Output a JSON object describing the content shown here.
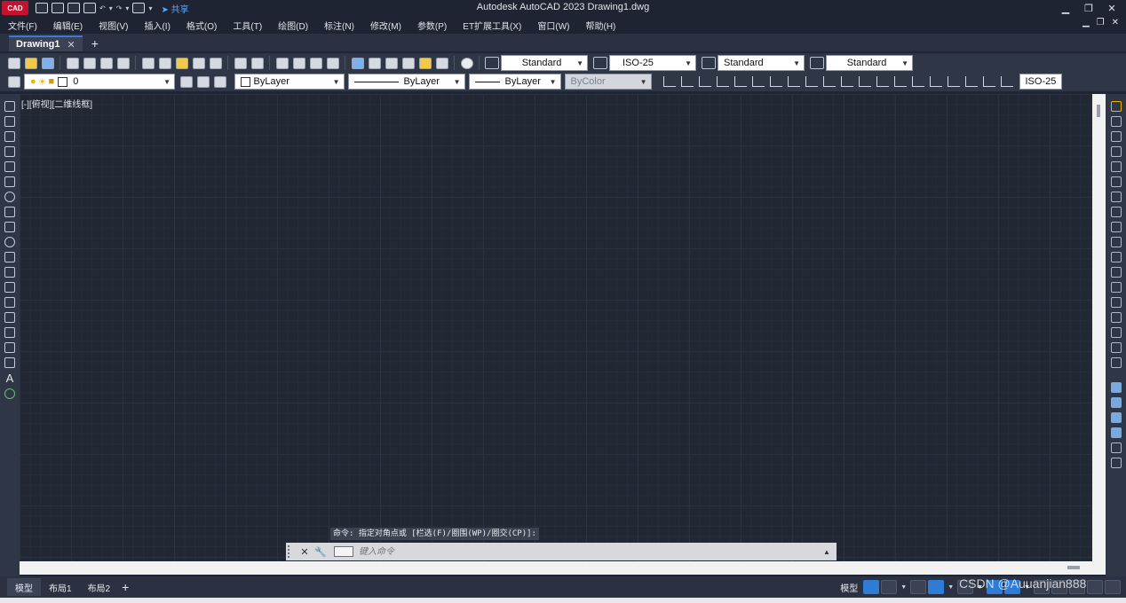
{
  "titlebar": {
    "logo_text": "CAD",
    "share_label": "共享",
    "title": "Autodesk AutoCAD 2023    Drawing1.dwg",
    "minimize": "▁",
    "restore": "❐",
    "close": "✕"
  },
  "menu": {
    "items": [
      "文件(F)",
      "编辑(E)",
      "视图(V)",
      "插入(I)",
      "格式(O)",
      "工具(T)",
      "绘图(D)",
      "标注(N)",
      "修改(M)",
      "参数(P)",
      "ET扩展工具(X)",
      "窗口(W)",
      "帮助(H)"
    ],
    "doc_minimize": "▁",
    "doc_restore": "❐",
    "doc_close": "✕"
  },
  "file_tabs": {
    "active": "Drawing1",
    "close": "✕",
    "add": "+"
  },
  "toolbar1": {
    "text_style": "Standard",
    "dim_style": "ISO-25",
    "table_style": "Standard",
    "mleader_style": "Standard"
  },
  "toolbar2": {
    "layer": "0",
    "color": "ByLayer",
    "linetype": "ByLayer",
    "lineweight": "ByLayer",
    "plot_style": "ByColor",
    "dim_style_right": "ISO-25"
  },
  "left_tools": {
    "text_tool": "A"
  },
  "viewport": {
    "label": "[-][俯视][二维线框]"
  },
  "command": {
    "history": "命令: 指定对角点或 [栏选(F)/圈围(WP)/圈交(CP)]:",
    "close": "✕",
    "customize": "🔧",
    "placeholder": "键入命令",
    "expand": "▲"
  },
  "layout_tabs": {
    "items": [
      "模型",
      "布局1",
      "布局2"
    ],
    "add": "+"
  },
  "statusbar": {
    "model": "模型"
  },
  "watermark": "CSDN @Auuanjian888",
  "colors": {
    "accent": "#3a7bd5",
    "logo": "#c4122f",
    "canvas": "#212733",
    "status_on": "#2f7cd6"
  }
}
